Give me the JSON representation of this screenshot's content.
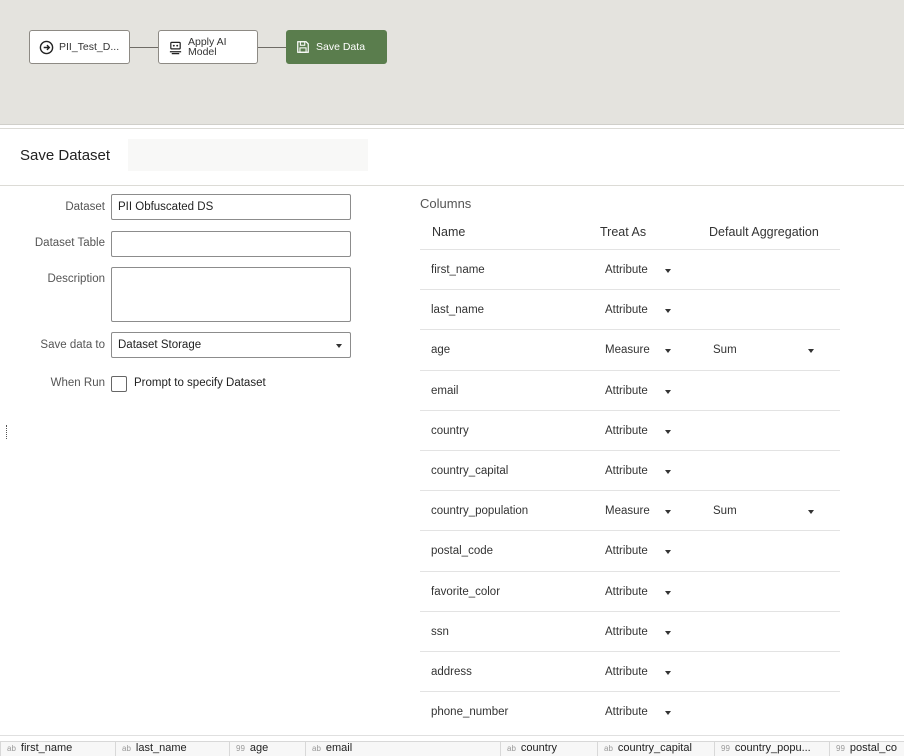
{
  "flow": {
    "nodes": [
      {
        "label": "PII_Test_D...",
        "icon": "arrow-circle-icon"
      },
      {
        "label": "Apply AI Model",
        "icon": "ai-model-icon"
      },
      {
        "label": "Save Data",
        "icon": "save-disk-icon"
      }
    ],
    "colors": {
      "active_node": "#5a7d4d",
      "canvas": "#e4e3de"
    }
  },
  "panel": {
    "title": "Save Dataset"
  },
  "form": {
    "dataset_label": "Dataset",
    "dataset_value": "PII Obfuscated DS",
    "table_label": "Dataset Table",
    "table_value": "",
    "description_label": "Description",
    "description_value": "",
    "save_to_label": "Save data to",
    "save_to_value": "Dataset Storage",
    "when_run_label": "When Run",
    "prompt_label": "Prompt to specify Dataset"
  },
  "columns": {
    "heading": "Columns",
    "headers": {
      "name": "Name",
      "treat_as": "Treat As",
      "aggregation": "Default Aggregation"
    },
    "rows": [
      {
        "name": "first_name",
        "treat_as": "Attribute",
        "aggregation": ""
      },
      {
        "name": "last_name",
        "treat_as": "Attribute",
        "aggregation": ""
      },
      {
        "name": "age",
        "treat_as": "Measure",
        "aggregation": "Sum"
      },
      {
        "name": "email",
        "treat_as": "Attribute",
        "aggregation": ""
      },
      {
        "name": "country",
        "treat_as": "Attribute",
        "aggregation": ""
      },
      {
        "name": "country_capital",
        "treat_as": "Attribute",
        "aggregation": ""
      },
      {
        "name": "country_population",
        "treat_as": "Measure",
        "aggregation": "Sum"
      },
      {
        "name": "postal_code",
        "treat_as": "Attribute",
        "aggregation": ""
      },
      {
        "name": "favorite_color",
        "treat_as": "Attribute",
        "aggregation": ""
      },
      {
        "name": "ssn",
        "treat_as": "Attribute",
        "aggregation": ""
      },
      {
        "name": "address",
        "treat_as": "Attribute",
        "aggregation": ""
      },
      {
        "name": "phone_number",
        "treat_as": "Attribute",
        "aggregation": ""
      }
    ]
  },
  "grid": {
    "columns": [
      {
        "type": "ab",
        "name": "first_name"
      },
      {
        "type": "ab",
        "name": "last_name"
      },
      {
        "type": "99",
        "name": "age"
      },
      {
        "type": "ab",
        "name": "email"
      },
      {
        "type": "ab",
        "name": "country"
      },
      {
        "type": "ab",
        "name": "country_capital"
      },
      {
        "type": "99",
        "name": "country_popu..."
      },
      {
        "type": "99",
        "name": "postal_co"
      }
    ]
  }
}
